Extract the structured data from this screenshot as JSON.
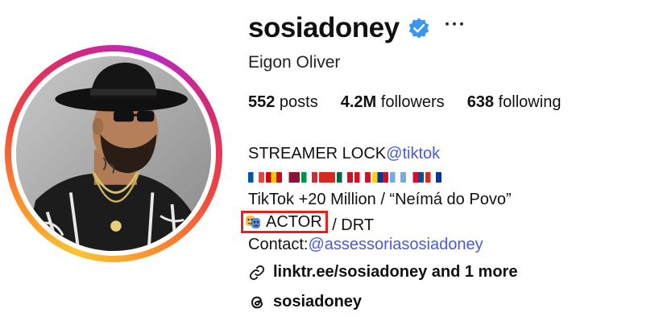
{
  "profile": {
    "username": "sosiadoney",
    "verified": true,
    "more_label": "···",
    "full_name": "Eigon Oliver"
  },
  "stats": {
    "posts_count": "552",
    "posts_label": " posts",
    "followers_count": "4.2M",
    "followers_label": " followers",
    "following_count": "638",
    "following_label": " following"
  },
  "bio": {
    "line1_text": "STREAMER LOCK",
    "line1_link": "@tiktok",
    "flags": [
      {
        "name": "France",
        "colors": [
          "#0055a4",
          "#ffffff",
          "#ef4135"
        ]
      },
      {
        "name": "Spain",
        "colors": [
          "#c60b1e",
          "#ffc400",
          "#c60b1e"
        ]
      },
      {
        "name": "Qatar",
        "colors": [
          "#ffffff",
          "#8a1538",
          "#8a1538"
        ]
      },
      {
        "name": "Italy",
        "colors": [
          "#009246",
          "#ffffff",
          "#ce2b37"
        ]
      },
      {
        "name": "Switzerland",
        "colors": [
          "#d52b1e",
          "#d52b1e",
          "#d52b1e"
        ]
      },
      {
        "name": "Mexico",
        "colors": [
          "#006847",
          "#ffffff",
          "#ce1126"
        ]
      },
      {
        "name": "Peru",
        "colors": [
          "#d91023",
          "#ffffff",
          "#d91023"
        ]
      },
      {
        "name": "Colombia",
        "colors": [
          "#fcd116",
          "#003893",
          "#ce1126"
        ]
      },
      {
        "name": "Argentina",
        "colors": [
          "#74acdf",
          "#ffffff",
          "#74acdf"
        ]
      },
      {
        "name": "Panama",
        "colors": [
          "#ffffff",
          "#d21034",
          "#005293"
        ]
      },
      {
        "name": "Paraguay",
        "colors": [
          "#d52b1e",
          "#ffffff",
          "#0038a8"
        ]
      }
    ],
    "line3": "TikTok +20 Million / “Neímá do Povo”",
    "actor_label": "ACTOR",
    "actor_suffix": " / DRT",
    "contact_label": "Contact:",
    "contact_link": "@assessoriasosiadoney"
  },
  "links": {
    "label": "linktr.ee/sosiadoney and 1 more",
    "icon": "link-icon"
  },
  "threads": {
    "label": "sosiadoney",
    "icon": "threads-icon"
  },
  "colors": {
    "link": "#4a5bd6",
    "verified": "#3897f0",
    "highlight_box": "#e3221b"
  }
}
